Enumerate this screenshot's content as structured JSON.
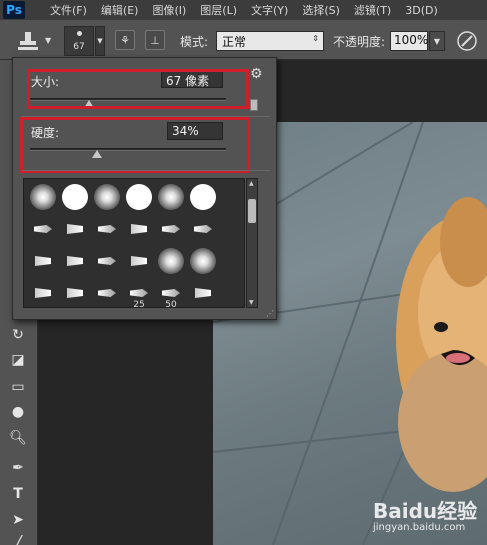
{
  "app": {
    "logo": "Ps"
  },
  "menu": [
    "文件(F)",
    "编辑(E)",
    "图像(I)",
    "图层(L)",
    "文字(Y)",
    "选择(S)",
    "滤镜(T)",
    "3D(D)"
  ],
  "options": {
    "brush_size_label": "67",
    "mode_label": "模式:",
    "mode_value": "正常",
    "opacity_label": "不透明度:",
    "opacity_value": "100%"
  },
  "brush_panel": {
    "size_label": "大小:",
    "size_value": "67 像素",
    "size_fraction": 0.3,
    "hardness_label": "硬度:",
    "hardness_value": "34%",
    "hardness_fraction": 0.34,
    "preset_sizes": [
      "25",
      "50"
    ]
  },
  "watermark": {
    "title": "Baidu经验",
    "subtitle": "jingyan.baidu.com"
  },
  "colors": {
    "highlight": "#d01d2a",
    "panel_bg": "#535353",
    "logo_blue": "#31a8ff"
  }
}
